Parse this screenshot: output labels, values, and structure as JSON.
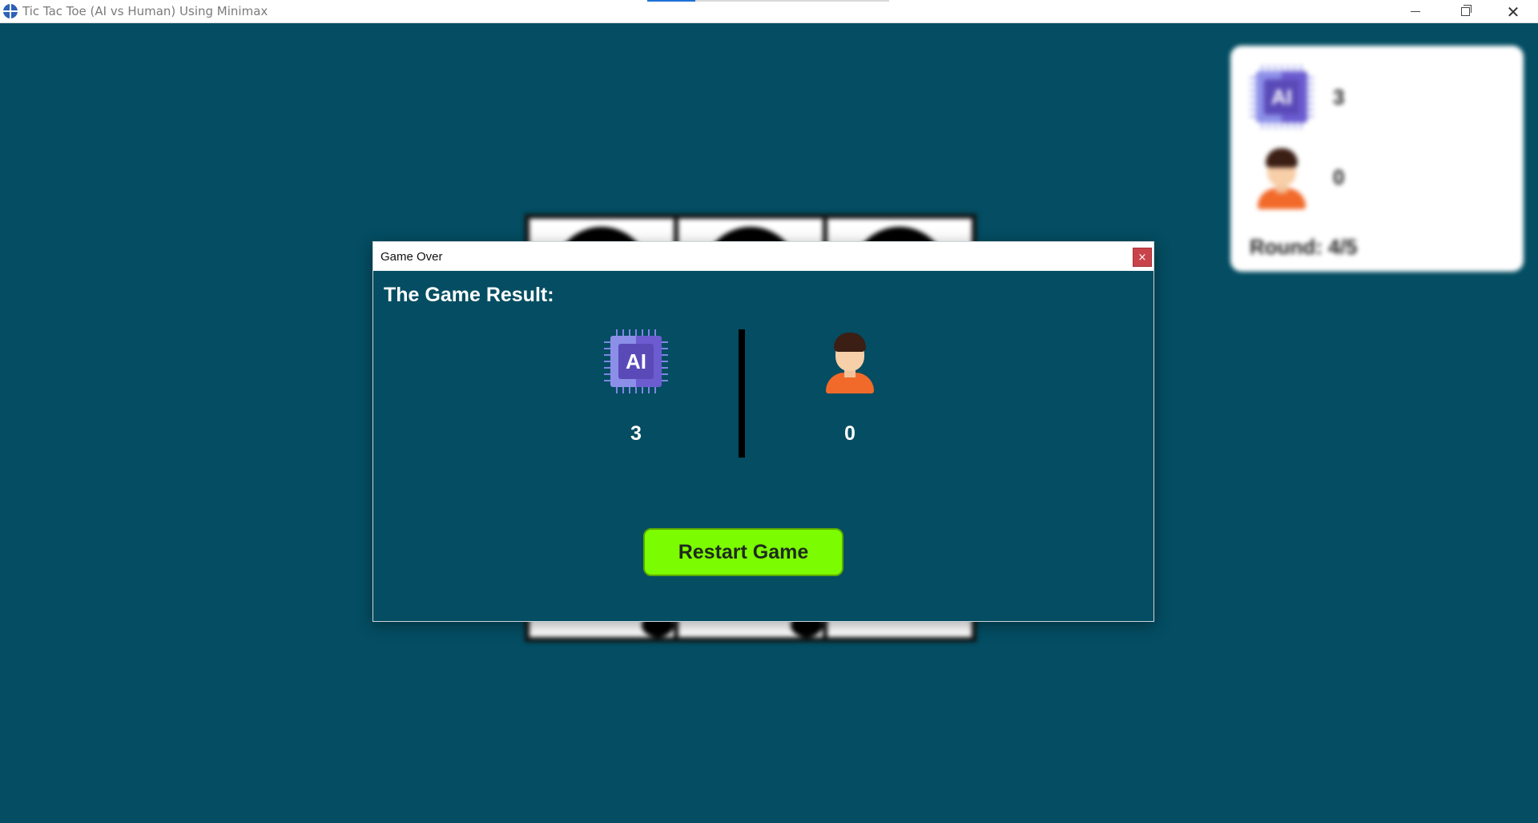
{
  "window": {
    "title": "Tic Tac Toe (AI vs Human) Using Minimax",
    "icon": "globe-app-icon",
    "title_progress": 0.2
  },
  "scoreboard": {
    "ai_icon": "ai-chip-icon",
    "ai_score": "3",
    "human_icon": "human-avatar-icon",
    "human_score": "0",
    "round_label": "Round: 4/5"
  },
  "dialog": {
    "title": "Game Over",
    "close_label": "×",
    "heading": "The Game Result:",
    "ai_label": "AI",
    "ai_score": "3",
    "human_score": "0",
    "restart_label": "Restart Game"
  },
  "colors": {
    "background": "#044d62",
    "restart_button": "#7cfc00",
    "close_button": "#c9434b",
    "human_shirt": "#f26a2a",
    "ai_chip": "#6b5cd0"
  }
}
